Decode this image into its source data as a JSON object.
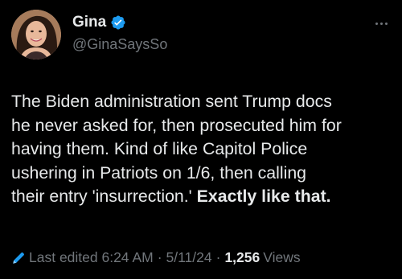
{
  "author": {
    "display_name": "Gina",
    "handle": "@GinaSaysSo",
    "verified": true
  },
  "tweet": {
    "lines": [
      "The Biden administration sent Trump docs",
      "he never asked for, then prosecuted him for",
      "having them. Kind of like Capitol Police",
      "ushering in Patriots on 1/6, then calling",
      "their entry 'insurrection.'"
    ],
    "emphasis": "Exactly like that."
  },
  "meta": {
    "edited_label": "Last edited 6:24 AM",
    "date": "5/11/24",
    "separator": "·",
    "views_count": "1,256",
    "views_label": "Views"
  },
  "icons": {
    "verified": "verified-badge-icon",
    "more": "more-options-icon",
    "edit": "pencil-icon"
  },
  "colors": {
    "background": "#000000",
    "text_primary": "#e7e9ea",
    "text_secondary": "#71767b",
    "verified_blue": "#1d9bf0"
  }
}
